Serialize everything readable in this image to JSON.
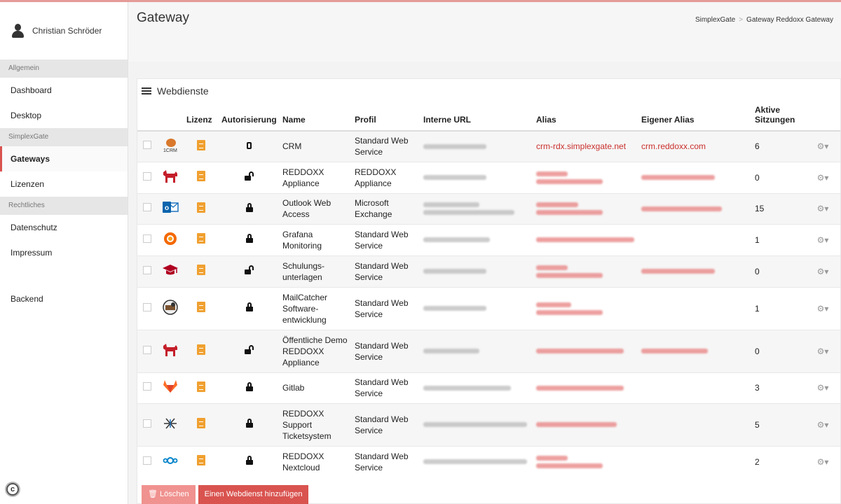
{
  "user": {
    "name": "Christian Schröder"
  },
  "sidebar": {
    "sections": [
      {
        "label": "Allgemein",
        "items": [
          "Dashboard",
          "Desktop"
        ]
      },
      {
        "label": "SimplexGate",
        "items": [
          "Gateways",
          "Lizenzen"
        ]
      },
      {
        "label": "Rechtliches",
        "items": [
          "Datenschutz",
          "Impressum"
        ]
      }
    ],
    "backend": "Backend",
    "active": "Gateways"
  },
  "header": {
    "title": "Gateway",
    "breadcrumb": [
      "SimplexGate",
      "Gateway Reddoxx Gateway"
    ]
  },
  "panel": {
    "title": "Webdienste",
    "columns": [
      "",
      "",
      "Lizenz",
      "Autorisierung",
      "Name",
      "Profil",
      "Interne URL",
      "Alias",
      "Eigener Alias",
      "Aktive Sitzungen",
      ""
    ],
    "rows": [
      {
        "icon": "crm-icon",
        "auth": "mobile",
        "name": "CRM",
        "profile": "Standard Web Service",
        "alias": "crm-rdx.simplexgate.net",
        "own_alias": "crm.reddoxx.com",
        "sessions": "6"
      },
      {
        "icon": "reddoxx-dog-icon",
        "auth": "unlocked",
        "name": "REDDOXX Appliance",
        "profile": "REDDOXX Appliance",
        "alias": "",
        "own_alias": "",
        "sessions": "0"
      },
      {
        "icon": "outlook-icon",
        "auth": "locked",
        "name": "Outlook Web Access",
        "profile": "Microsoft Exchange",
        "alias": "",
        "own_alias": "",
        "sessions": "15"
      },
      {
        "icon": "grafana-icon",
        "auth": "locked",
        "name": "Grafana Monitoring",
        "profile": "Standard Web Service",
        "alias": "",
        "own_alias": "",
        "sessions": "1"
      },
      {
        "icon": "graduation-cap-icon",
        "auth": "unlocked",
        "name": "Schulungs-unterlagen",
        "profile": "Standard Web Service",
        "alias": "",
        "own_alias": "",
        "sessions": "0"
      },
      {
        "icon": "mailcatcher-icon",
        "auth": "locked",
        "name": "MailCatcher Software-entwicklung",
        "profile": "Standard Web Service",
        "alias": "",
        "own_alias": "",
        "sessions": "1"
      },
      {
        "icon": "reddoxx-dog-icon",
        "auth": "unlocked",
        "name": "Öffentliche Demo REDDOXX Appliance",
        "profile": "Standard Web Service",
        "alias": "",
        "own_alias": "",
        "sessions": "0"
      },
      {
        "icon": "gitlab-icon",
        "auth": "locked",
        "name": "Gitlab",
        "profile": "Standard Web Service",
        "alias": "",
        "own_alias": "",
        "sessions": "3"
      },
      {
        "icon": "osticket-icon",
        "auth": "locked",
        "name": "REDDOXX Support Ticketsystem",
        "profile": "Standard Web Service",
        "alias": "",
        "own_alias": "",
        "sessions": "5"
      },
      {
        "icon": "nextcloud-icon",
        "auth": "locked",
        "name": "REDDOXX Nextcloud",
        "profile": "Standard Web Service",
        "alias": "",
        "own_alias": "",
        "sessions": "2"
      }
    ]
  },
  "buttons": {
    "delete": "Löschen",
    "add": "Einen Webdienst hinzufügen"
  },
  "colors": {
    "accent": "#d9534f",
    "license": "#f0a030",
    "link": "#c9302c"
  }
}
